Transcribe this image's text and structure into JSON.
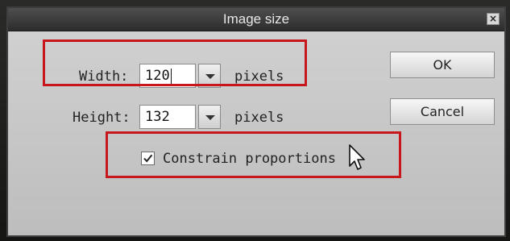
{
  "dialog": {
    "title": "Image size",
    "close_symbol": "×",
    "width": {
      "label": "Width:",
      "value": "120",
      "unit": "pixels"
    },
    "height": {
      "label": "Height:",
      "value": "132",
      "unit": "pixels"
    },
    "constrain": {
      "label": "Constrain proportions",
      "checked": true
    },
    "buttons": {
      "ok": "OK",
      "cancel": "Cancel"
    }
  },
  "icons": {
    "close": "close-icon",
    "dropdown": "chevron-down-icon",
    "check": "check-icon",
    "cursor": "mouse-pointer-icon"
  },
  "colors": {
    "highlight": "#c8161d",
    "titlebar": "#3a3a3a",
    "dialog_bg": "#c9c9c9"
  }
}
